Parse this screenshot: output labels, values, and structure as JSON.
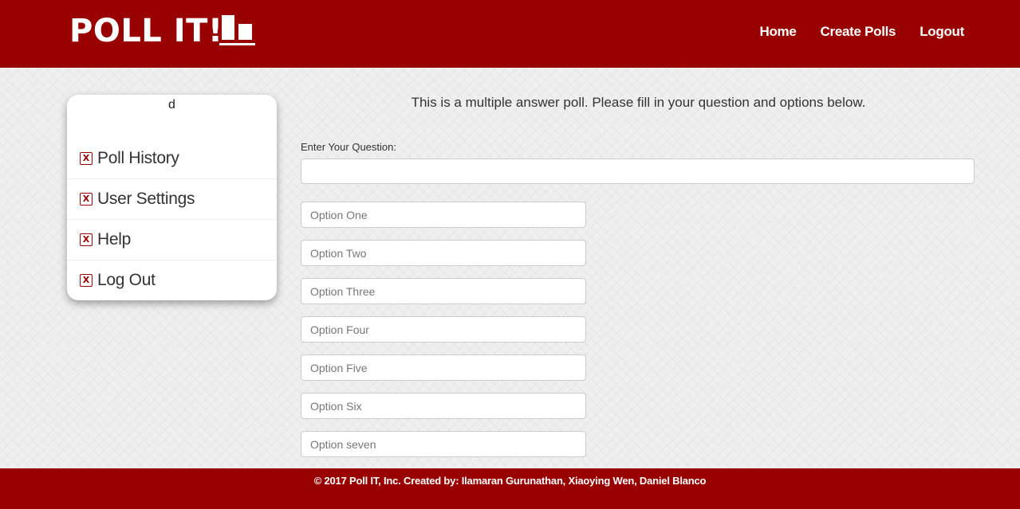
{
  "header": {
    "brand": "POLL IT!",
    "brand_icon": "bar-chart-icon",
    "nav": [
      {
        "label": "Home"
      },
      {
        "label": "Create Polls"
      },
      {
        "label": "Logout"
      }
    ]
  },
  "sidebar": {
    "username": "d",
    "items": [
      {
        "label": "Poll History",
        "icon": "x-box-icon"
      },
      {
        "label": "User Settings",
        "icon": "x-box-icon"
      },
      {
        "label": "Help",
        "icon": "x-box-icon"
      },
      {
        "label": "Log Out",
        "icon": "x-box-icon"
      }
    ]
  },
  "main": {
    "intro": "This is a multiple answer poll. Please fill in your question and options below.",
    "question_label": "Enter Your Question:",
    "question_value": "",
    "options": [
      {
        "placeholder": "Option One"
      },
      {
        "placeholder": "Option Two"
      },
      {
        "placeholder": "Option Three"
      },
      {
        "placeholder": "Option Four"
      },
      {
        "placeholder": "Option Five"
      },
      {
        "placeholder": "Option Six"
      },
      {
        "placeholder": "Option seven"
      }
    ]
  },
  "footer": {
    "text": "© 2017 Poll IT, Inc. Created by: Ilamaran Gurunathan, Xiaoying Wen, Daniel Blanco"
  },
  "colors": {
    "brand": "#990000",
    "background": "#efefef",
    "panel": "#ffffff"
  }
}
